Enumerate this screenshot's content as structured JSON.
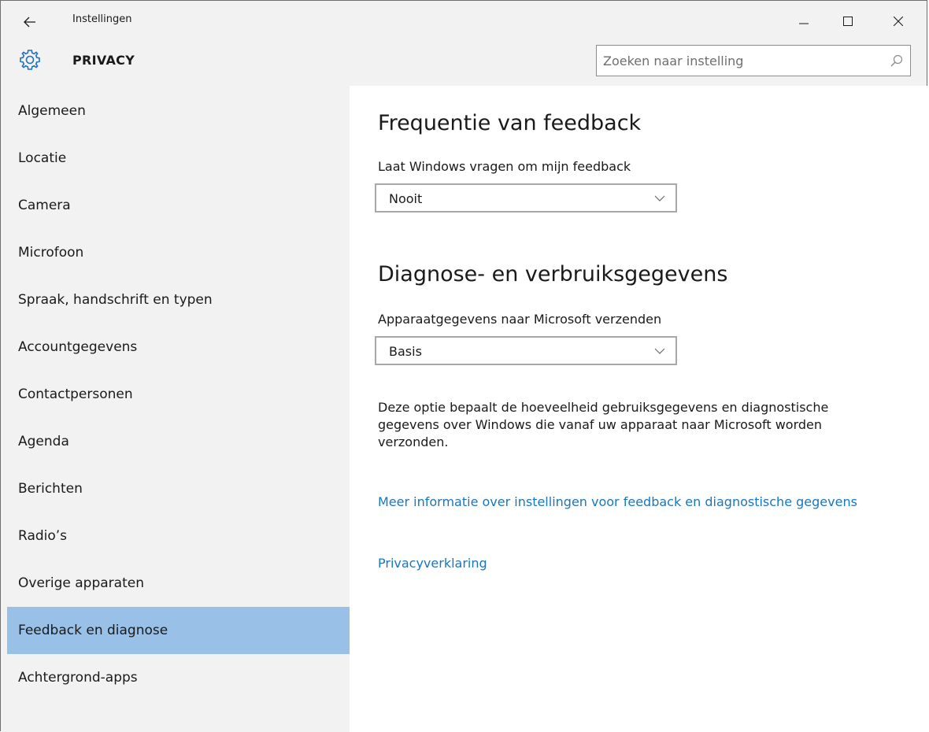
{
  "window": {
    "app_title": "Instellingen",
    "controls": {
      "minimize_glyph": "–",
      "maximize_glyph": "☐",
      "close_glyph": "✕"
    }
  },
  "header": {
    "icon": "gear-icon",
    "title": "PRIVACY",
    "search": {
      "placeholder": "Zoeken naar instelling",
      "value": "",
      "icon": "search-icon"
    }
  },
  "sidebar": {
    "items": [
      {
        "label": "Algemeen",
        "selected": false
      },
      {
        "label": "Locatie",
        "selected": false
      },
      {
        "label": "Camera",
        "selected": false
      },
      {
        "label": "Microfoon",
        "selected": false
      },
      {
        "label": "Spraak, handschrift en typen",
        "selected": false
      },
      {
        "label": "Accountgegevens",
        "selected": false
      },
      {
        "label": "Contactpersonen",
        "selected": false
      },
      {
        "label": "Agenda",
        "selected": false
      },
      {
        "label": "Berichten",
        "selected": false
      },
      {
        "label": "Radio’s",
        "selected": false
      },
      {
        "label": "Overige apparaten",
        "selected": false
      },
      {
        "label": "Feedback en diagnose",
        "selected": true
      },
      {
        "label": "Achtergrond-apps",
        "selected": false
      }
    ],
    "selected_color": "#99c0e7"
  },
  "main": {
    "feedback": {
      "heading": "Frequentie van feedback",
      "label": "Laat Windows vragen om mijn feedback",
      "dropdown_value": "Nooit"
    },
    "diagnostics": {
      "heading": "Diagnose- en verbruiksgegevens",
      "label": "Apparaatgegevens naar Microsoft verzenden",
      "dropdown_value": "Basis",
      "description": "Deze optie bepaalt de hoeveelheid gebruiksgegevens en diagnostische gegevens over Windows die vanaf uw apparaat naar Microsoft worden verzonden."
    },
    "links": {
      "more_info": "Meer informatie over instellingen voor feedback en diagnostische gegevens",
      "privacy_statement": "Privacyverklaring"
    },
    "link_color": "#1976c0"
  }
}
